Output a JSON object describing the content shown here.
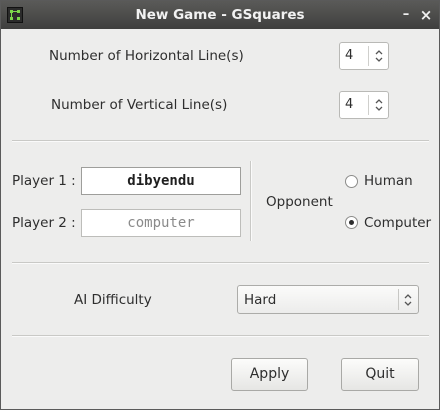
{
  "window": {
    "title": "New Game - GSquares",
    "minimize_glyph": "–",
    "close_glyph": "×"
  },
  "grid": {
    "horizontal_label": "Number of Horizontal Line(s)",
    "horizontal_value": "4",
    "vertical_label": "Number of Vertical Line(s)",
    "vertical_value": "4"
  },
  "players": {
    "player1_label": "Player 1 :",
    "player1_value": "dibyendu",
    "player2_label": "Player 2 :",
    "player2_value": "computer"
  },
  "opponent": {
    "label": "Opponent",
    "options": [
      {
        "label": "Human",
        "selected": false
      },
      {
        "label": "Computer",
        "selected": true
      }
    ]
  },
  "ai": {
    "label": "AI Difficulty",
    "selected": "Hard"
  },
  "buttons": {
    "apply": "Apply",
    "quit": "Quit"
  },
  "icons": [
    "app-icon",
    "minimize-icon",
    "close-icon",
    "spin-arrows-icon",
    "combo-arrows-icon"
  ]
}
